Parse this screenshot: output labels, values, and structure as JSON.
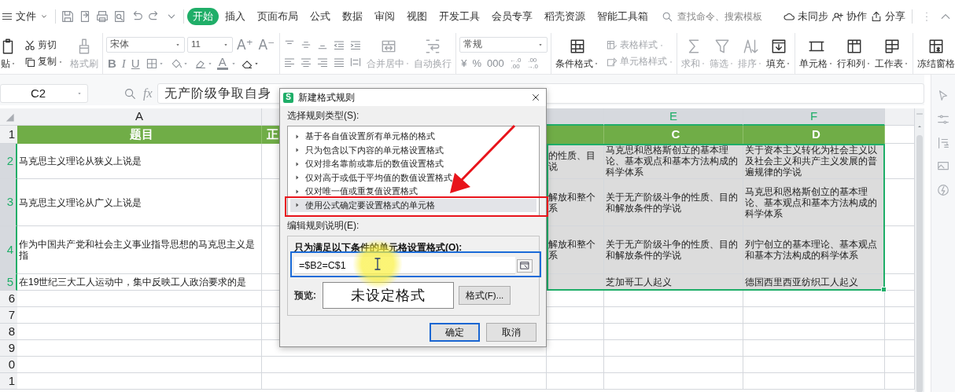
{
  "menu": {
    "file": "文件",
    "tabs": [
      {
        "label": "开始",
        "selected": true
      },
      {
        "label": "插入",
        "selected": false
      },
      {
        "label": "页面布局",
        "selected": false
      },
      {
        "label": "公式",
        "selected": false
      },
      {
        "label": "数据",
        "selected": false
      },
      {
        "label": "审阅",
        "selected": false
      },
      {
        "label": "视图",
        "selected": false
      },
      {
        "label": "开发工具",
        "selected": false
      },
      {
        "label": "会员专享",
        "selected": false
      },
      {
        "label": "稻壳资源",
        "selected": false
      },
      {
        "label": "智能工具箱",
        "selected": false
      }
    ],
    "search": {
      "placeholder": "查找命令、搜索模板"
    },
    "actions": [
      {
        "label": "未同步"
      },
      {
        "label": "协作"
      },
      {
        "label": "分享"
      }
    ]
  },
  "ribbon": {
    "groups": [
      {
        "kind": "paste",
        "items": [
          {
            "label": "贴",
            "disabled": false,
            "dropdown": true
          }
        ]
      },
      {
        "kind": "pair",
        "items": [
          {
            "label": "剪切",
            "disabled": false,
            "dropdown": false
          },
          {
            "label": "复制",
            "disabled": false,
            "dropdown": true
          }
        ]
      },
      {
        "kind": "large",
        "items": [
          {
            "label": "格式刷",
            "disabled": true,
            "dropdown": false
          }
        ]
      },
      {
        "kind": "font",
        "font": "宋体",
        "size": "11",
        "grow": "A⁺",
        "shrink": "A⁻",
        "bold": "B",
        "italic": "I",
        "underline": "U",
        "font_color": "A"
      },
      {
        "kind": "align",
        "items": [
          {
            "label": "合并居中",
            "disabled": true,
            "dropdown": true
          },
          {
            "label": "自动换行",
            "disabled": true,
            "dropdown": false
          }
        ]
      },
      {
        "kind": "number",
        "format": "常规",
        "symbols": [
          "¥",
          "%",
          "000"
        ],
        "decimals": [
          {
            "top": "←.0",
            "bottom": ".00"
          },
          {
            "top": ".00",
            "bottom": "→.0"
          }
        ]
      },
      {
        "kind": "large",
        "items": [
          {
            "label": "条件格式",
            "disabled": false,
            "dropdown": true
          }
        ]
      },
      {
        "kind": "pair",
        "items": [
          {
            "label": "表格样式",
            "disabled": true,
            "dropdown": true
          },
          {
            "label": "单元格样式",
            "disabled": true,
            "dropdown": true
          }
        ]
      },
      {
        "kind": "large",
        "items": [
          {
            "label": "求和",
            "disabled": true,
            "dropdown": true
          },
          {
            "label": "筛选",
            "disabled": true,
            "dropdown": true
          },
          {
            "label": "排序",
            "disabled": true,
            "dropdown": true
          },
          {
            "label": "填充",
            "disabled": false,
            "dropdown": true
          }
        ]
      },
      {
        "kind": "large",
        "items": [
          {
            "label": "单元格",
            "disabled": false,
            "dropdown": true
          },
          {
            "label": "行和列",
            "disabled": false,
            "dropdown": true
          },
          {
            "label": "工作表",
            "disabled": false,
            "dropdown": true
          }
        ]
      },
      {
        "kind": "large",
        "items": [
          {
            "label": "冻结窗格",
            "disabled": false,
            "dropdown": false
          }
        ]
      }
    ]
  },
  "formula_bar": {
    "name_box": "C2",
    "function_label": "fx",
    "formula": "无产阶级争取自身"
  },
  "sheet": {
    "header_number": "1",
    "columns": [
      {
        "letter": "A",
        "title": "题目",
        "selected": false
      },
      {
        "title": "正",
        "selected": false
      },
      {
        "selected": true
      },
      {
        "letter": "E",
        "title": "C",
        "selected": true
      },
      {
        "letter": "F",
        "title": "D",
        "selected": true
      }
    ],
    "rows": [
      {
        "number": "2",
        "selected": true,
        "cells": [
          "马克思主义理论从狭义上说是",
          null,
          "的性质、目说",
          "马克思和恩格斯创立的基本理论、基本观点和基本方法构成的科学体系",
          "关于资本主义转化为社会主义以及社会主义和共产主义发展的普遍规律的学说"
        ]
      },
      {
        "number": "3",
        "selected": true,
        "cells": [
          "马克思主义理论从广义上说是",
          null,
          "解放和整个系",
          "关于无产阶级斗争的性质、目的和解放条件的学说",
          "马克思和恩格斯创立的基本理论、基本观点和基本方法构成的科学体系"
        ]
      },
      {
        "number": "4",
        "selected": true,
        "cells": [
          "作为中国共产党和社会主义事业指导思想的马克思主义是指",
          null,
          "解放和整个系",
          "关于无产阶级斗争的性质、目的和解放条件的学说",
          "列宁创立的基本理论、基本观点和基本方法构成的科学体系"
        ]
      },
      {
        "number": "5",
        "selected": true,
        "cells": [
          "在19世纪三大工人运动中，集中反映工人政治要求的是",
          null,
          null,
          "芝加哥工人起义",
          "德国西里西亚纺织工人起义"
        ]
      },
      {
        "number": "6",
        "selected": false
      },
      {
        "number": "7",
        "selected": false
      },
      {
        "number": "8",
        "selected": false
      },
      {
        "number": "9",
        "selected": false
      },
      {
        "number": "0",
        "selected": false
      },
      {
        "number": "1",
        "selected": false
      }
    ]
  },
  "dialog": {
    "title": "新建格式规则",
    "app_mark": "S",
    "type_label": "选择规则类型(S):",
    "rule_types": [
      {
        "label": "基于各自值设置所有单元格的格式",
        "selected": false
      },
      {
        "label": "只为包含以下内容的单元格设置格式",
        "selected": false
      },
      {
        "label": "仅对排名靠前或靠后的数值设置格式",
        "selected": false
      },
      {
        "label": "仅对高于或低于平均值的数值设置格式",
        "selected": false
      },
      {
        "label": "仅对唯一值或重复值设置格式",
        "selected": false
      },
      {
        "label": "使用公式确定要设置格式的单元格",
        "selected": true
      }
    ],
    "description_label": "编辑规则说明(E):",
    "condition_label": "只为满足以下条件的单元格设置格式(O):",
    "formula": "=$B2=C$1",
    "preview_label": "预览:",
    "preview_text": "未设定格式",
    "format_button": "格式(F)...",
    "buttons": [
      {
        "label": "确定",
        "default": true
      },
      {
        "label": "取消",
        "default": false
      }
    ]
  }
}
